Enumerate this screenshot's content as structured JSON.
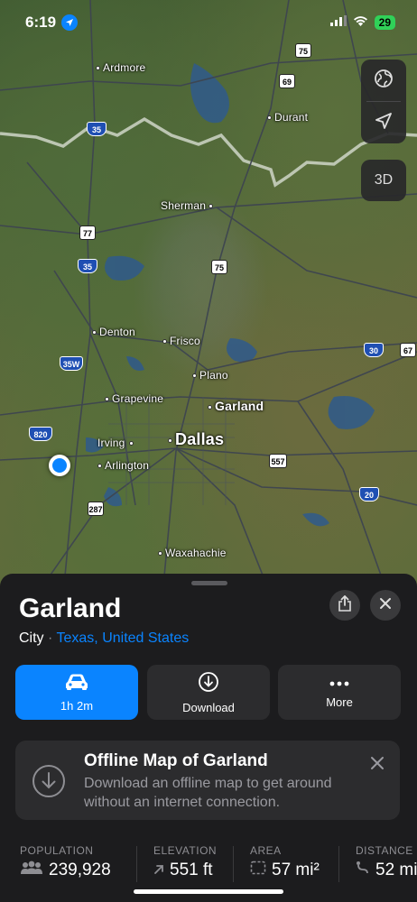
{
  "status_bar": {
    "time": "6:19",
    "battery": "29"
  },
  "map": {
    "cities": [
      {
        "name": "Ardmore"
      },
      {
        "name": "Durant"
      },
      {
        "name": "Sherman"
      },
      {
        "name": "Denton"
      },
      {
        "name": "Frisco"
      },
      {
        "name": "Plano"
      },
      {
        "name": "Grapevine"
      },
      {
        "name": "Garland"
      },
      {
        "name": "Irving"
      },
      {
        "name": "Dallas"
      },
      {
        "name": "Arlington"
      },
      {
        "name": "Waxahachie"
      }
    ],
    "shields": [
      "75",
      "69",
      "35",
      "77",
      "35",
      "75",
      "35W",
      "820",
      "287",
      "557",
      "30",
      "67",
      "20"
    ],
    "controls": {
      "three_d": "3D"
    }
  },
  "place": {
    "title": "Garland",
    "type": "City",
    "region": "Texas, United States"
  },
  "actions": {
    "drive": "1h 2m",
    "download": "Download",
    "more": "More"
  },
  "offline": {
    "title": "Offline Map of Garland",
    "description": "Download an offline map to get around without an internet connection."
  },
  "stats": [
    {
      "label": "POPULATION",
      "value": "239,928",
      "icon": "people-icon"
    },
    {
      "label": "ELEVATION",
      "value": "551 ft",
      "icon": "elevation-arrow-icon"
    },
    {
      "label": "AREA",
      "value": "57 mi²",
      "icon": "area-icon"
    },
    {
      "label": "DISTANCE",
      "value": "52 mi",
      "icon": "distance-icon"
    }
  ],
  "colors": {
    "accent": "#0a84ff",
    "sheet": "#1c1c1e",
    "card": "#2c2c2e"
  }
}
